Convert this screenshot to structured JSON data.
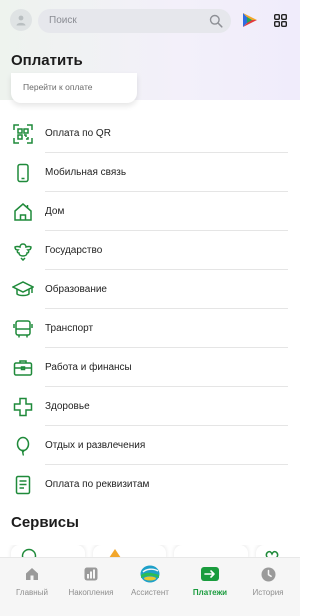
{
  "search": {
    "placeholder": "Поиск"
  },
  "pay_section": {
    "title": "Оплатить",
    "card_label": "Перейти к оплате"
  },
  "menu": [
    {
      "label": "Оплата по QR",
      "icon": "qr-scan-icon"
    },
    {
      "label": "Мобильная связь",
      "icon": "phone-icon"
    },
    {
      "label": "Дом",
      "icon": "house-icon"
    },
    {
      "label": "Государство",
      "icon": "coat-of-arms-icon"
    },
    {
      "label": "Образование",
      "icon": "graduation-cap-icon"
    },
    {
      "label": "Транспорт",
      "icon": "bus-icon"
    },
    {
      "label": "Работа и финансы",
      "icon": "briefcase-icon"
    },
    {
      "label": "Здоровье",
      "icon": "medical-cross-icon"
    },
    {
      "label": "Отдых и развлечения",
      "icon": "balloon-icon"
    },
    {
      "label": "Оплата по реквизитам",
      "icon": "document-icon"
    }
  ],
  "services_section": {
    "title": "Сервисы"
  },
  "tabbar": {
    "items": [
      {
        "label": "Главный",
        "icon": "home-icon",
        "active": false
      },
      {
        "label": "Накопления",
        "icon": "chart-icon",
        "active": false
      },
      {
        "label": "Ассистент",
        "icon": "assistant-icon",
        "active": false
      },
      {
        "label": "Платежи",
        "icon": "transfer-icon",
        "active": true
      },
      {
        "label": "История",
        "icon": "clock-icon",
        "active": false
      }
    ]
  },
  "colors": {
    "accent": "#1a9c3e",
    "icon_green": "#1f8a3a"
  }
}
